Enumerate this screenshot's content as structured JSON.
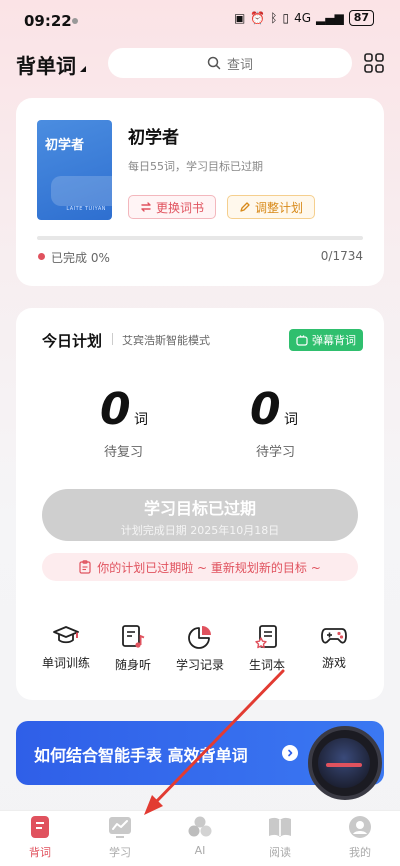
{
  "status": {
    "time": "09:22",
    "network": "4G",
    "battery": "87"
  },
  "header": {
    "title": "背单词",
    "search_placeholder": "查词"
  },
  "book": {
    "cover_title": "初学者",
    "cover_subtitle": "LAITE TUIYAN",
    "name": "初学者",
    "description": "每日55词，学习目标已过期",
    "change_label": "更换词书",
    "adjust_label": "调整计划",
    "progress_label": "已完成 0%",
    "progress_fraction": 0,
    "count": "0/1734"
  },
  "plan": {
    "title": "今日计划",
    "mode": "艾宾浩斯智能模式",
    "danmu_label": "弹幕背词",
    "review_count": "0",
    "learn_count": "0",
    "unit": "词",
    "review_label": "待复习",
    "learn_label": "待学习",
    "expired_title": "学习目标已过期",
    "expired_date": "计划完成日期 2025年10月18日",
    "notice": "你的计划已过期啦 ~ 重新规划新的目标 ~"
  },
  "features": [
    {
      "label": "单词训练",
      "icon": "graduation-cap-icon"
    },
    {
      "label": "随身听",
      "icon": "music-note-icon"
    },
    {
      "label": "学习记录",
      "icon": "pie-chart-icon"
    },
    {
      "label": "生词本",
      "icon": "notebook-star-icon"
    },
    {
      "label": "游戏",
      "icon": "gamepad-icon"
    }
  ],
  "banner": {
    "text": "如何结合智能手表 高效背单词"
  },
  "tabs": [
    {
      "label": "背词",
      "icon": "book-icon",
      "active": true
    },
    {
      "label": "学习",
      "icon": "chart-icon",
      "active": false
    },
    {
      "label": "AI",
      "icon": "ai-icon",
      "active": false
    },
    {
      "label": "阅读",
      "icon": "read-icon",
      "active": false
    },
    {
      "label": "我的",
      "icon": "profile-icon",
      "active": false
    }
  ],
  "colors": {
    "accent": "#e0525e",
    "green": "#2fbf6e",
    "banner": "#2f5fe8",
    "orange": "#d88a1a"
  }
}
